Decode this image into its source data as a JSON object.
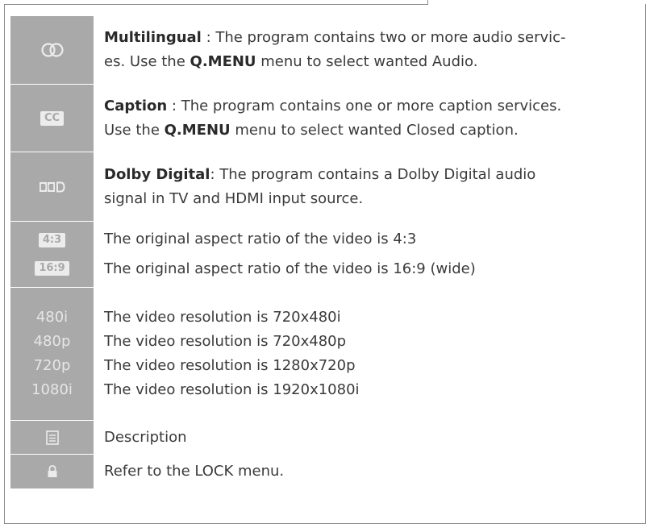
{
  "rows": {
    "multilingual": {
      "term": "Multilingual",
      "t1": " : The program contains two or more audio servic-",
      "t2": "es. Use the ",
      "key": "Q.MENU",
      "t3": " menu to select wanted Audio."
    },
    "caption": {
      "badge": "CC",
      "term": "Caption",
      "t1": " : The program contains one or more caption services.",
      "t2": "Use the ",
      "key": "Q.MENU",
      "t3": " menu to select wanted Closed caption."
    },
    "dolby": {
      "term": "Dolby Digital",
      "t1": ": The program contains a Dolby Digital audio",
      "t2": "signal in TV and HDMI input source."
    },
    "aspect": [
      {
        "badge": "4:3",
        "text": "The original aspect ratio of the video is 4:3"
      },
      {
        "badge": "16:9",
        "text": "The original aspect ratio of the video is 16:9 (wide)"
      }
    ],
    "resolution": [
      {
        "label": "480i",
        "text": "The video resolution is 720x480i"
      },
      {
        "label": "480p",
        "text": "The video resolution is 720x480p"
      },
      {
        "label": "720p",
        "text": "The video resolution is 1280x720p"
      },
      {
        "label": "1080i",
        "text": "The video resolution is 1920x1080i"
      }
    ],
    "description": {
      "text": "Description"
    },
    "lock": {
      "text": "Refer to the LOCK menu."
    }
  },
  "icons": {
    "multilingual": "double-circle-icon",
    "dolby": "dolby-digital-icon",
    "description": "document-lines-icon",
    "lock": "padlock-icon"
  },
  "colors": {
    "icon_column": "#a9a9a9",
    "text": "#3a3a3a",
    "icon_glyph": "#ececec"
  }
}
